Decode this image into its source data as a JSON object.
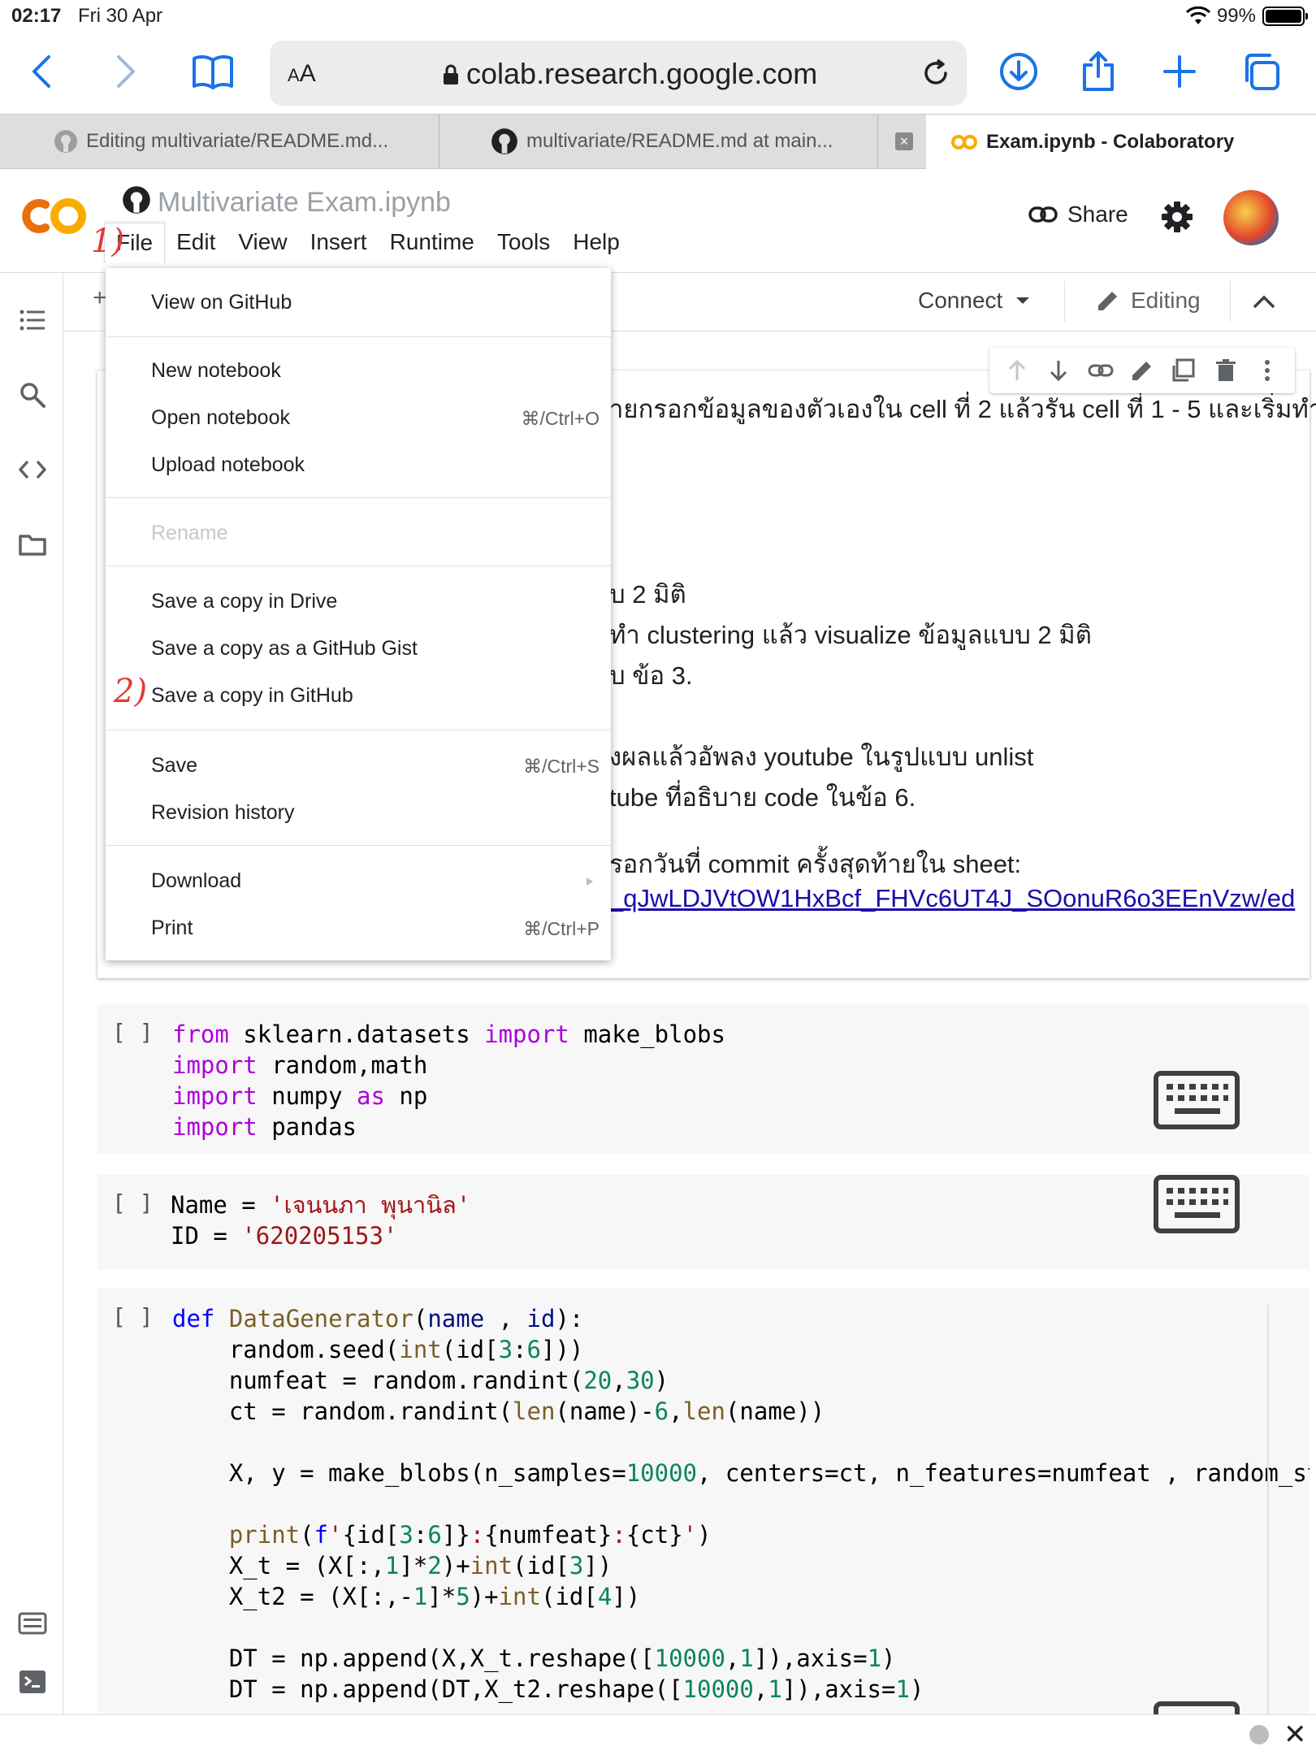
{
  "status_bar": {
    "time": "02:17",
    "date": "Fri 30 Apr",
    "battery": "99%",
    "battery_level": 0.99
  },
  "safari": {
    "text_size_label": "AA",
    "url": "colab.research.google.com"
  },
  "browser_tabs": [
    {
      "title": "Editing multivariate/README.md...",
      "active": false
    },
    {
      "title": "multivariate/README.md at main...",
      "active": false
    },
    {
      "title": "Exam.ipynb - Colaboratory",
      "active": true
    }
  ],
  "colab": {
    "notebook_title": "Multivariate Exam.ipynb",
    "menu": [
      "File",
      "Edit",
      "View",
      "Insert",
      "Runtime",
      "Tools",
      "Help"
    ],
    "share_label": "Share",
    "connect_label": "Connect",
    "editing_label": "Editing"
  },
  "file_menu": {
    "items": [
      {
        "label": "View on GitHub"
      },
      {
        "label": "New notebook"
      },
      {
        "label": "Open notebook",
        "shortcut": "⌘/Ctrl+O"
      },
      {
        "label": "Upload notebook"
      },
      {
        "label": "Rename",
        "disabled": true
      },
      {
        "label": "Save a copy in Drive"
      },
      {
        "label": "Save a copy as a GitHub Gist"
      },
      {
        "label": "Save a copy in GitHub"
      },
      {
        "label": "Save",
        "shortcut": "⌘/Ctrl+S"
      },
      {
        "label": "Revision history"
      },
      {
        "label": "Download"
      },
      {
        "label": "Print",
        "shortcut": "⌘/Ctrl+P"
      }
    ]
  },
  "annotations": {
    "step1": "1)",
    "step2": "2)"
  },
  "text_cell": {
    "lines": [
      "ายกรอกข้อมูลของตัวเองใน cell ที่ 2 แล้วรัน cell ที่ 1 - 5 และเริ่มทำ",
      "บ 2 มิติ",
      "ทำ clustering แล้ว visualize ข้อมูลแบบ 2 มิติ",
      "บ ข้อ 3.",
      "งผลแล้วอัพลง youtube ในรูปแบบ unlist",
      "tube ที่อธิบาย code ในข้อ 6.",
      "รอกวันที่ commit ครั้งสุดท้ายใน sheet:"
    ],
    "link": "_qJwLDJVtOW1HxBcf_FHVc6UT4J_SOonuR6o3EEnVzw/ed"
  },
  "code_cells": [
    {
      "bracket": "[ ]"
    },
    {
      "bracket": "[ ]",
      "name_value": "'เจนนภา พุนานิล'",
      "id_value": "'620205153'"
    },
    {
      "bracket": "[ ]"
    }
  ],
  "colors": {
    "accent": "#1a73e8",
    "colab_orange": "#f9ab00",
    "annotation_red": "#e53935"
  }
}
